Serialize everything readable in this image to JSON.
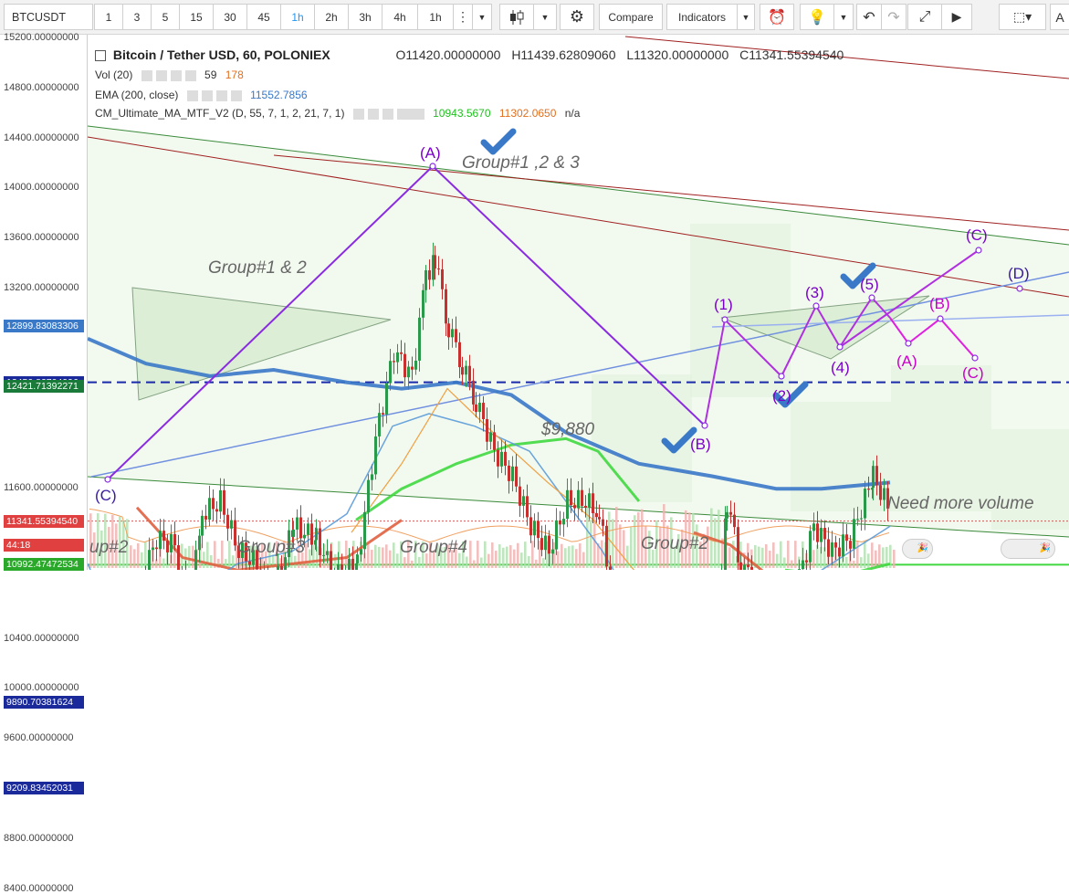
{
  "toolbar": {
    "symbol": "BTCUSDT",
    "intervals": [
      "1",
      "3",
      "5",
      "15",
      "30",
      "45",
      "1h",
      "2h",
      "3h",
      "4h",
      "1h"
    ],
    "active_interval": "1h",
    "compare": "Compare",
    "indicators": "Indicators"
  },
  "legend": {
    "title": "Bitcoin / Tether USD, 60, POLONIEX",
    "ohlc": {
      "o": "O11420.00000000",
      "h": "H11439.62809060",
      "l": "L11320.00000000",
      "c": "C11341.55394540"
    },
    "vol": {
      "name": "Vol (20)",
      "v1": "59",
      "v2": "178"
    },
    "ema": {
      "name": "EMA (200, close)",
      "value": "11552.7856"
    },
    "cm": {
      "name": "CM_Ultimate_MA_MTF_V2 (D, 55, 7, 1, 2, 21, 7, 1)",
      "v1": "10943.5670",
      "v2": "11302.0650",
      "v3": "n/a"
    }
  },
  "colors": {
    "ema200": "#3a78c8",
    "fastma": "#5a9ad8",
    "slowma": "#e06040",
    "ma55": "#40d840",
    "orange": "#f0a040",
    "wave": "#8a2be2",
    "wave2": "#d030d8",
    "check": "#3a78c8"
  },
  "chart_data": {
    "type": "candlestick",
    "symbol": "BTCUSDT",
    "interval": "1h",
    "ylim": [
      8100,
      15300
    ],
    "yticks": [
      {
        "v": 15200,
        "label": "15200.00000000"
      },
      {
        "v": 14800,
        "label": "14800.00000000"
      },
      {
        "v": 14400,
        "label": "14400.00000000"
      },
      {
        "v": 14000,
        "label": "14000.00000000"
      },
      {
        "v": 13600,
        "label": "13600.00000000"
      },
      {
        "v": 13200,
        "label": "13200.00000000"
      },
      {
        "v": 11600,
        "label": "11600.00000000"
      },
      {
        "v": 10400,
        "label": "10400.00000000"
      },
      {
        "v": 10000,
        "label": "10000.00000000"
      },
      {
        "v": 9600,
        "label": "9600.00000000"
      },
      {
        "v": 8800,
        "label": "8800.00000000"
      },
      {
        "v": 8400,
        "label": "8400.00000000"
      }
    ],
    "price_labels": [
      {
        "v": 12899.83083306,
        "label": "12899.83083306",
        "color": "#3a78c8"
      },
      {
        "v": 12450.82704996,
        "label": "12450.82704996",
        "color": "#1a2a9a"
      },
      {
        "v": 12421.71392271,
        "label": "12421.71392271",
        "color": "#1a7a3a"
      },
      {
        "v": 11341.5539454,
        "label": "11341.55394540",
        "color": "#e04040"
      },
      {
        "v": 11150,
        "label": "44:18",
        "color": "#e04040"
      },
      {
        "v": 10992.47472534,
        "label": "10992.47472534",
        "color": "#2aa82a"
      },
      {
        "v": 9890.70381624,
        "label": "9890.70381624",
        "color": "#1a2a9a"
      },
      {
        "v": 9209.83452031,
        "label": "9209.83452031",
        "color": "#1a2a9a"
      }
    ],
    "hlines": [
      12450.83,
      9890.7,
      9209.83
    ],
    "close_path": [
      [
        130,
        9300
      ],
      [
        150,
        10800
      ],
      [
        170,
        11200
      ],
      [
        190,
        11150
      ],
      [
        205,
        10600
      ],
      [
        220,
        11400
      ],
      [
        240,
        11500
      ],
      [
        260,
        11100
      ],
      [
        280,
        11000
      ],
      [
        295,
        10700
      ],
      [
        320,
        11300
      ],
      [
        345,
        11200
      ],
      [
        365,
        10900
      ],
      [
        390,
        11000
      ],
      [
        410,
        12000
      ],
      [
        430,
        12700
      ],
      [
        450,
        12500
      ],
      [
        465,
        13300
      ],
      [
        475,
        13450
      ],
      [
        490,
        12900
      ],
      [
        505,
        12600
      ],
      [
        520,
        12300
      ],
      [
        540,
        11900
      ],
      [
        560,
        11700
      ],
      [
        580,
        11300
      ],
      [
        600,
        11100
      ],
      [
        620,
        11500
      ],
      [
        640,
        11500
      ],
      [
        655,
        11400
      ],
      [
        670,
        10700
      ],
      [
        690,
        10450
      ],
      [
        710,
        10400
      ],
      [
        730,
        10700
      ],
      [
        750,
        10450
      ],
      [
        772,
        9900
      ],
      [
        785,
        10700
      ],
      [
        795,
        11500
      ],
      [
        810,
        11000
      ],
      [
        830,
        10800
      ],
      [
        855,
        10500
      ],
      [
        870,
        10800
      ],
      [
        890,
        11300
      ],
      [
        910,
        11100
      ],
      [
        930,
        11200
      ],
      [
        955,
        11700
      ],
      [
        975,
        11400
      ]
    ],
    "series": [
      {
        "name": "EMA (200, close)",
        "color": "#3a78c8",
        "values": [
          [
            96,
            12800
          ],
          [
            160,
            12600
          ],
          [
            230,
            12500
          ],
          [
            300,
            12550
          ],
          [
            380,
            12450
          ],
          [
            440,
            12400
          ],
          [
            500,
            12450
          ],
          [
            560,
            12350
          ],
          [
            620,
            12050
          ],
          [
            700,
            11800
          ],
          [
            780,
            11700
          ],
          [
            850,
            11600
          ],
          [
            900,
            11600
          ],
          [
            975,
            11650
          ]
        ]
      },
      {
        "name": "slow MA",
        "color": "#e06040",
        "values": [
          [
            150,
            11450
          ],
          [
            200,
            11050
          ],
          [
            260,
            10950
          ],
          [
            320,
            11000
          ],
          [
            380,
            11050
          ],
          [
            440,
            11350
          ]
        ]
      },
      {
        "name": "slow MA 2",
        "color": "#e06040",
        "values": [
          [
            760,
            11250
          ],
          [
            800,
            11150
          ],
          [
            860,
            10800
          ],
          [
            900,
            10600
          ],
          [
            940,
            10550
          ],
          [
            975,
            10750
          ]
        ]
      },
      {
        "name": "CM MA",
        "color": "#40d840",
        "values": [
          [
            390,
            11350
          ],
          [
            440,
            11600
          ],
          [
            500,
            11800
          ],
          [
            560,
            11950
          ],
          [
            620,
            12000
          ],
          [
            655,
            11900
          ],
          [
            700,
            11500
          ]
        ]
      },
      {
        "name": "CM MA 2",
        "color": "#40d840",
        "values": [
          [
            860,
            10950
          ],
          [
            920,
            10900
          ],
          [
            975,
            11000
          ]
        ]
      },
      {
        "name": "fast MA",
        "color": "#5a9ad8",
        "values": [
          [
            96,
            11000
          ],
          [
            140,
            10300
          ],
          [
            200,
            10700
          ],
          [
            260,
            11000
          ],
          [
            320,
            11100
          ],
          [
            380,
            11400
          ],
          [
            430,
            12100
          ],
          [
            470,
            12200
          ],
          [
            520,
            12100
          ],
          [
            580,
            11900
          ],
          [
            620,
            11500
          ],
          [
            660,
            11100
          ],
          [
            700,
            10600
          ],
          [
            760,
            10500
          ],
          [
            800,
            10800
          ],
          [
            850,
            10700
          ],
          [
            900,
            10950
          ],
          [
            975,
            11300
          ]
        ]
      }
    ]
  },
  "annotations": {
    "group123": "Group#1 ,2 & 3",
    "group12": "Group#1 & 2",
    "price9880": "$9,880",
    "needvolume": "Need more volume",
    "g_up2": "up#2",
    "g3": "Group#3",
    "g4": "Group#4",
    "g2": "Group#2",
    "A": "(A)",
    "B": "(B)",
    "C": "(C)",
    "w1": "(1)",
    "w2": "(2)",
    "w3": "(3)",
    "w4": "(4)",
    "w5": "(5)",
    "fA": "(A)",
    "fB": "(B)",
    "fC": "(C)",
    "fC2": "(C)",
    "fD": "(D)"
  }
}
